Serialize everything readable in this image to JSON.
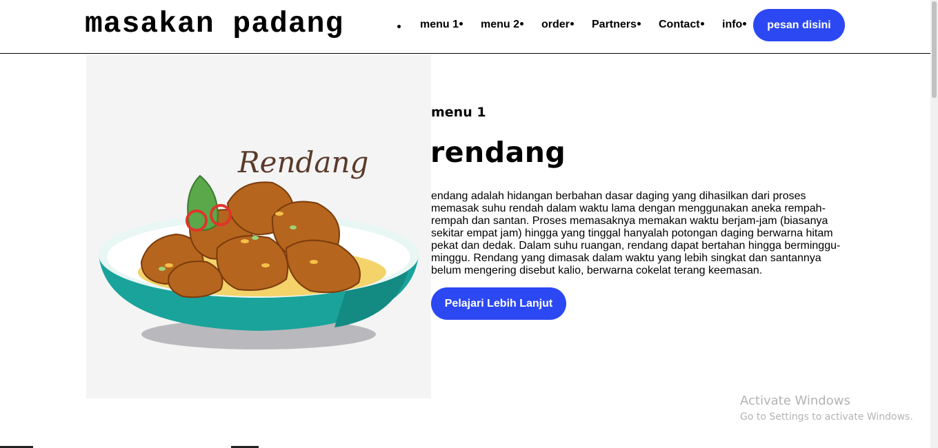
{
  "header": {
    "brand": "masakan padang",
    "nav": [
      {
        "label": "menu 1"
      },
      {
        "label": "menu 2"
      },
      {
        "label": "order"
      },
      {
        "label": "Partners"
      },
      {
        "label": "Contact"
      },
      {
        "label": "info"
      }
    ],
    "cta_label": "pesan disini"
  },
  "hero": {
    "image_text": "Rendang"
  },
  "content": {
    "eyebrow": "menu 1",
    "title": "rendang",
    "description": "endang adalah hidangan berbahan dasar daging yang dihasilkan dari proses memasak suhu rendah dalam waktu lama dengan menggunakan aneka rempah-rempah dan santan. Proses memasaknya memakan waktu berjam-jam (biasanya sekitar empat jam) hingga yang tinggal hanyalah potongan daging berwarna hitam pekat dan dedak. Dalam suhu ruangan, rendang dapat bertahan hingga berminggu-minggu. Rendang yang dimasak dalam waktu yang lebih singkat dan santannya belum mengering disebut kalio, berwarna cokelat terang keemasan.",
    "button_label": "Pelajari Lebih Lanjut"
  },
  "watermark": {
    "title": "Activate Windows",
    "subtitle": "Go to Settings to activate Windows."
  },
  "colors": {
    "accent": "#2b48f3",
    "bowl": "#1aa39a",
    "meat": "#b5651d"
  }
}
